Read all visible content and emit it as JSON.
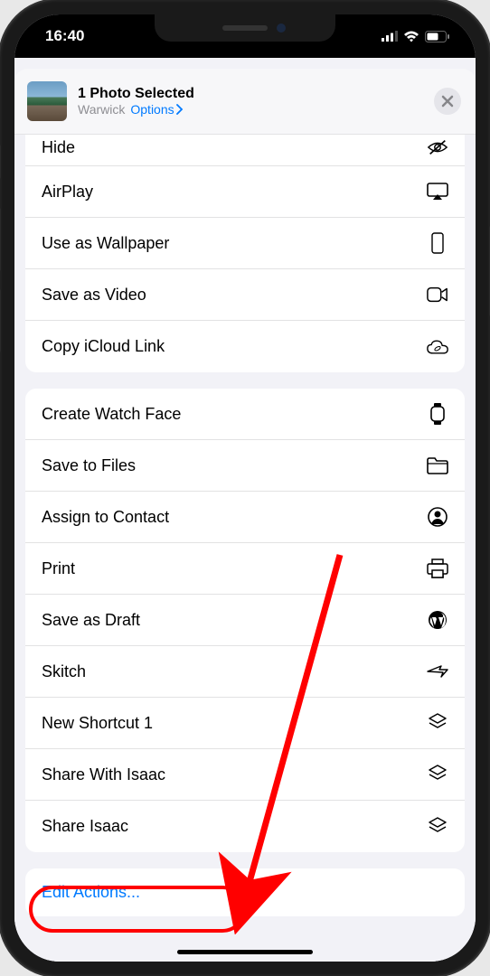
{
  "status": {
    "time": "16:40"
  },
  "header": {
    "title": "1 Photo Selected",
    "subtitle": "Warwick",
    "options_label": "Options"
  },
  "group1": [
    {
      "label": "Hide",
      "icon": "eye-slash-icon"
    },
    {
      "label": "AirPlay",
      "icon": "airplay-icon"
    },
    {
      "label": "Use as Wallpaper",
      "icon": "phone-outline-icon"
    },
    {
      "label": "Save as Video",
      "icon": "video-icon"
    },
    {
      "label": "Copy iCloud Link",
      "icon": "cloud-link-icon"
    }
  ],
  "group2": [
    {
      "label": "Create Watch Face",
      "icon": "watch-icon"
    },
    {
      "label": "Save to Files",
      "icon": "folder-icon"
    },
    {
      "label": "Assign to Contact",
      "icon": "contact-icon"
    },
    {
      "label": "Print",
      "icon": "printer-icon"
    },
    {
      "label": "Save as Draft",
      "icon": "wordpress-icon"
    },
    {
      "label": "Skitch",
      "icon": "skitch-icon"
    },
    {
      "label": "New Shortcut 1",
      "icon": "shortcut-icon"
    },
    {
      "label": "Share With Isaac",
      "icon": "shortcut-icon"
    },
    {
      "label": "Share Isaac",
      "icon": "shortcut-icon"
    }
  ],
  "edit_actions": "Edit Actions..."
}
